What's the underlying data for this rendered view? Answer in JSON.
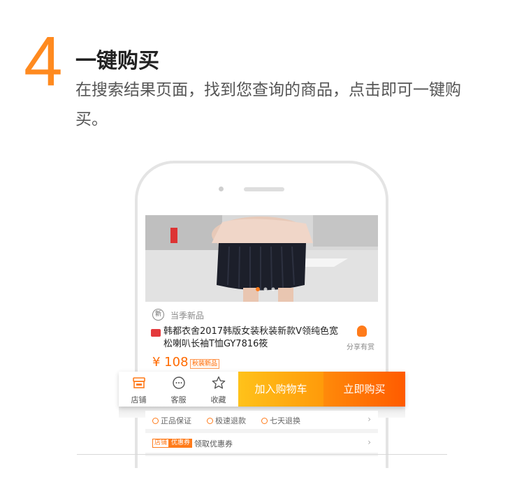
{
  "step": {
    "number": "4",
    "title": "一键购买",
    "description": "在搜索结果页面，找到您查询的商品，点击即可一键购买。"
  },
  "product": {
    "new_badge": "新",
    "new_label": "当季新品",
    "title": "韩都衣舍2017韩版女装秋装新款V领纯色宽松喇叭长袖T恤GY7816筱",
    "share_label": "分享有赏",
    "price": "¥ 108",
    "price_tag": "秋装新品"
  },
  "action_bar": {
    "store": "店铺",
    "service": "客服",
    "favorite": "收藏",
    "add_to_cart": "加入购物车",
    "buy_now": "立即购买"
  },
  "guarantees": [
    "正品保证",
    "极速退款",
    "七天退换"
  ],
  "coupon": {
    "tag_store": "店铺",
    "tag_coupon": "优惠券",
    "label": "领取优惠券"
  },
  "colors": {
    "accent": "#ff8a1f",
    "cart_button": "#ffb012",
    "buy_button": "#ff6a00"
  }
}
